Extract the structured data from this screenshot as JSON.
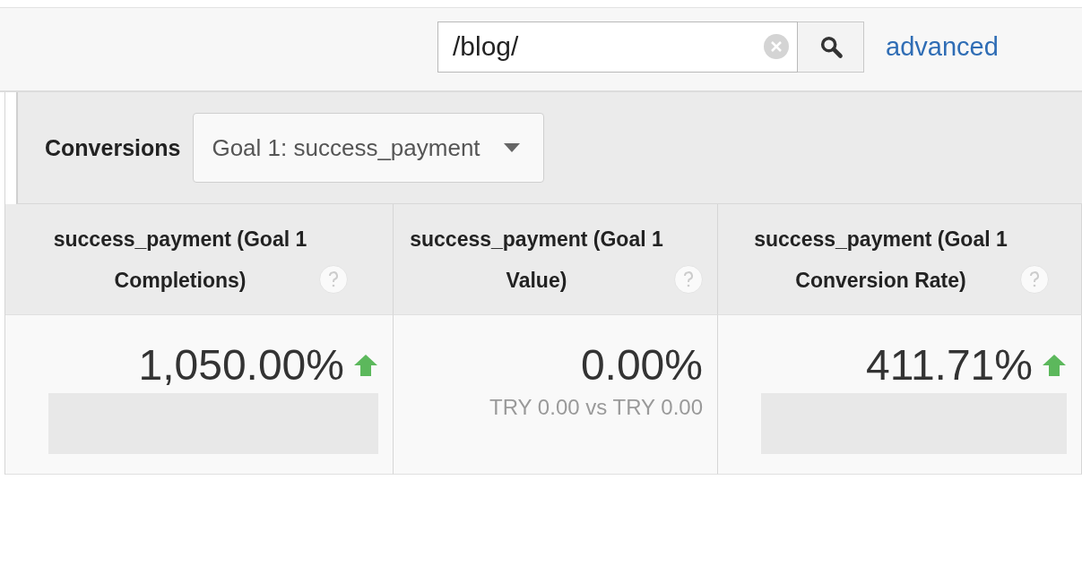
{
  "search": {
    "value": "/blog/",
    "advanced_link": "advanced"
  },
  "conversions": {
    "label": "Conversions",
    "goal_select": "Goal 1: success_payment"
  },
  "metrics": [
    {
      "header": "success_payment (Goal 1 Completions)",
      "value": "1,050.00%",
      "trending_up": true
    },
    {
      "header": "success_payment (Goal 1 Value)",
      "value": "0.00%",
      "trending_up": false,
      "comparison": "TRY 0.00 vs TRY 0.00"
    },
    {
      "header": "success_payment (Goal 1 Conversion Rate)",
      "value": "411.71%",
      "trending_up": true
    }
  ]
}
